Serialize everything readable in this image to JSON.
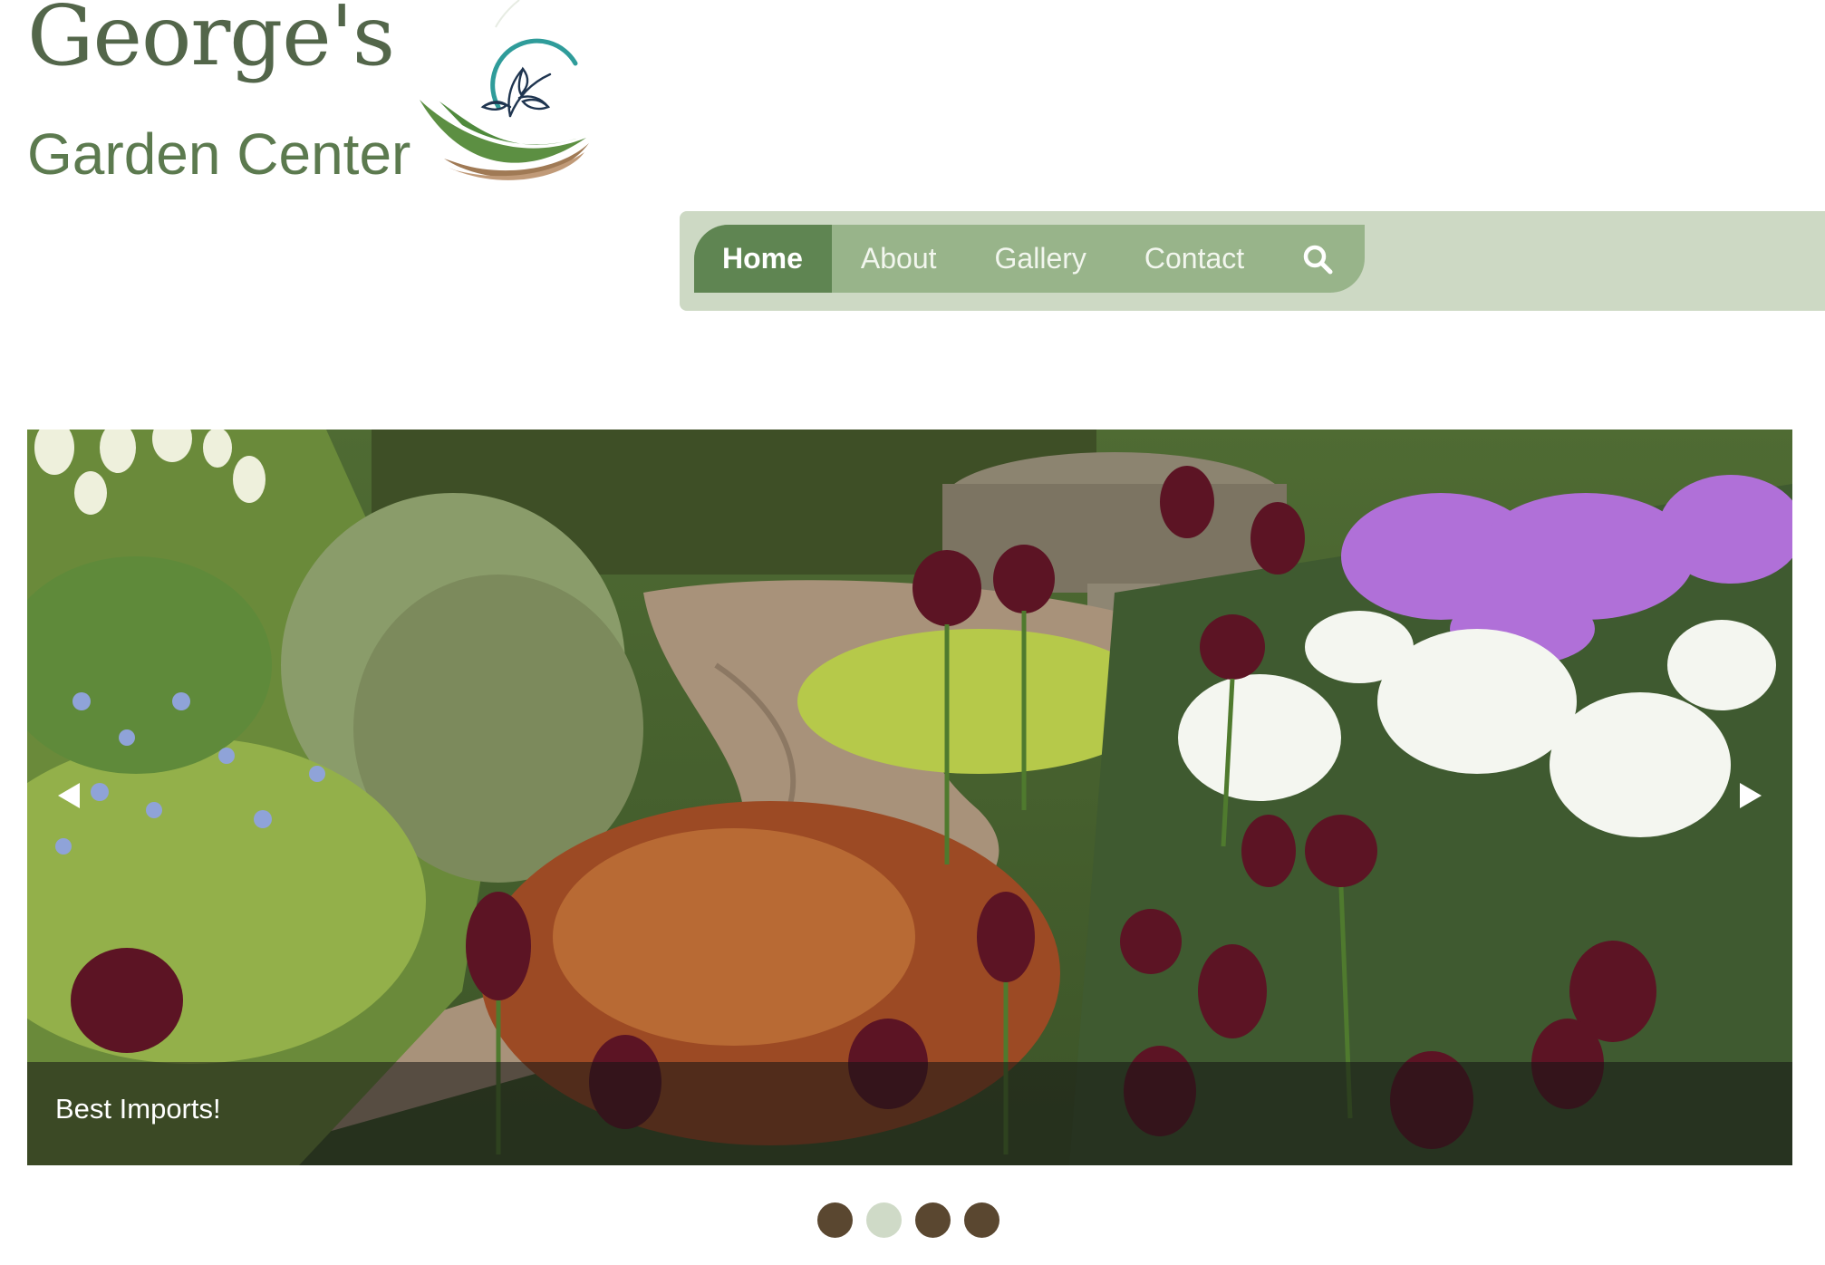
{
  "header": {
    "title_line1": "George's",
    "title_line2": "Garden Center",
    "logo_icon": "leaf-swoosh-logo"
  },
  "nav": {
    "items": [
      {
        "label": "Home",
        "active": true
      },
      {
        "label": "About",
        "active": false
      },
      {
        "label": "Gallery",
        "active": false
      },
      {
        "label": "Contact",
        "active": false
      }
    ],
    "search_icon": "search-icon"
  },
  "slider": {
    "caption": "Best Imports!",
    "prev_icon": "triangle-left-icon",
    "next_icon": "triangle-right-icon",
    "slide_count": 4,
    "active_index": 1
  },
  "colors": {
    "title_green": "#53664a",
    "nav_bar": "#cdd9c4",
    "nav_pill": "#98b48a",
    "nav_active": "#5f8552",
    "dot": "#5a4730",
    "dot_active": "#cfdac7"
  }
}
